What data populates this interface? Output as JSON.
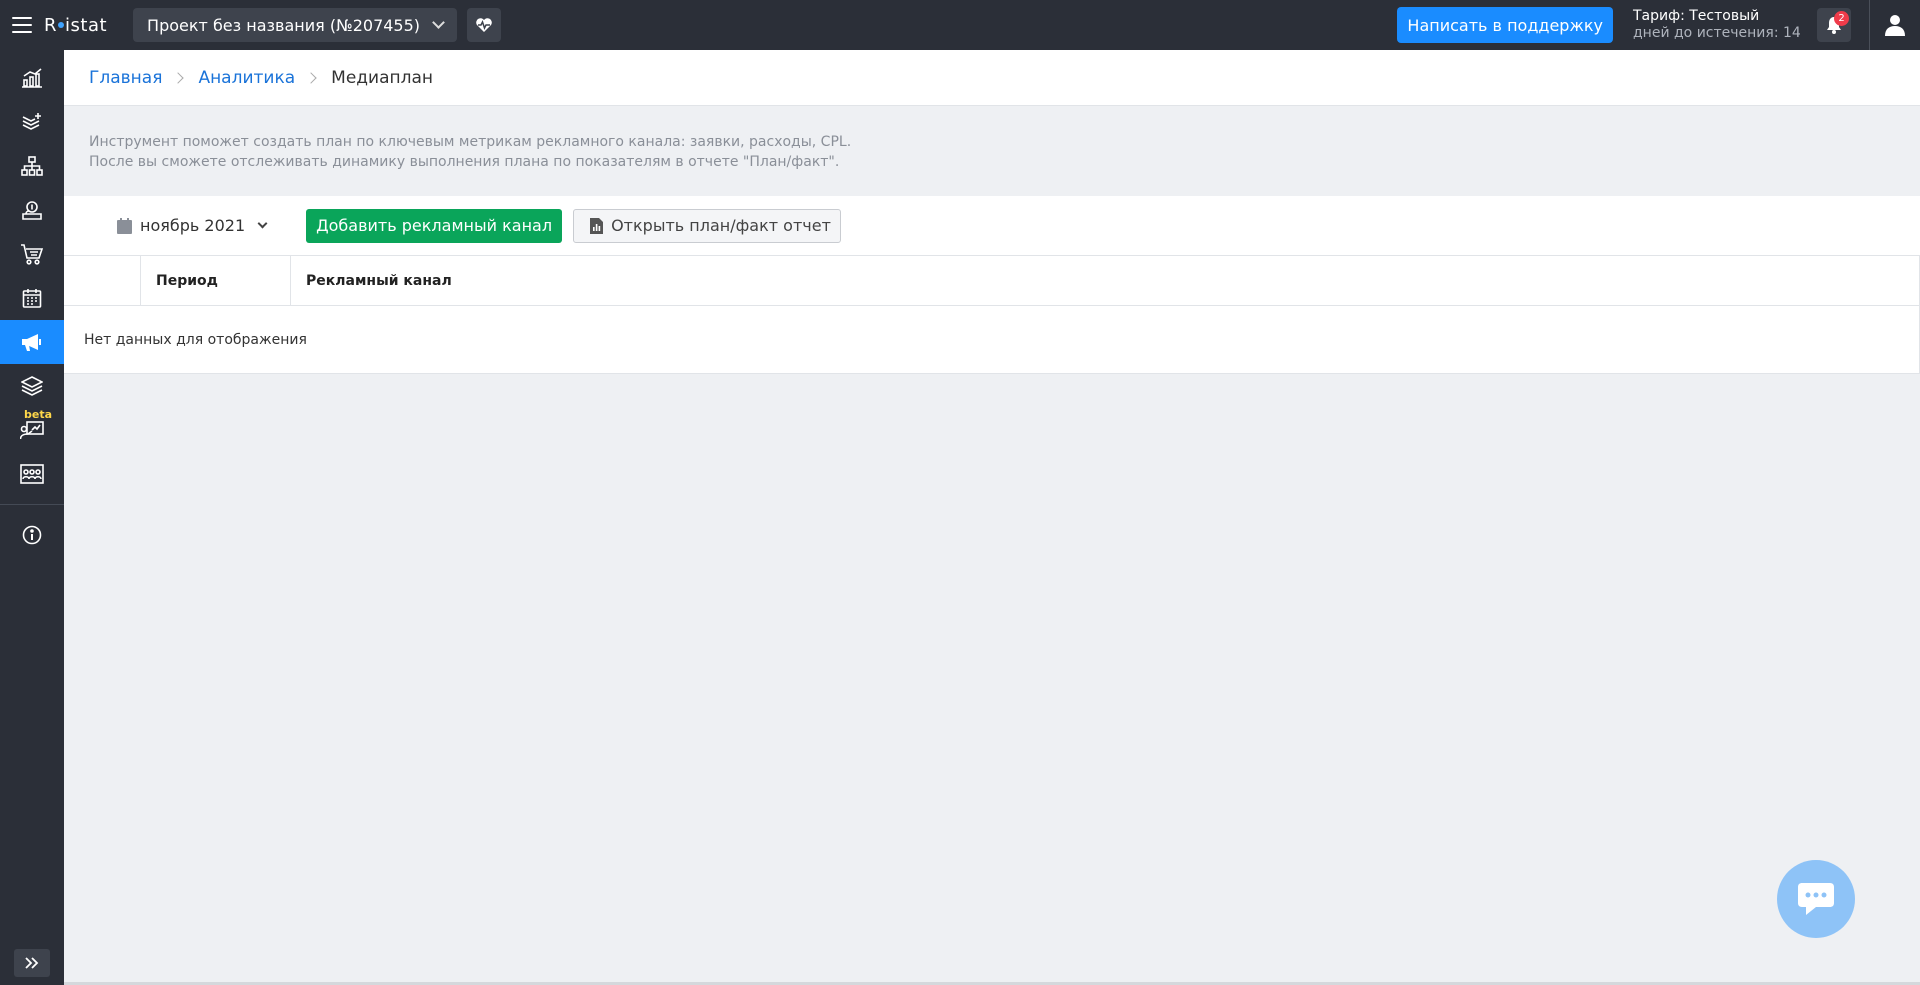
{
  "app": {
    "logo_text_pre": "R",
    "logo_text_post": "istat"
  },
  "header": {
    "project_name": "Проект без названия (№207455)",
    "support_label": "Написать в поддержку",
    "tariff_label": "Тариф: Тестовый",
    "days_left_label": "дней до истечения: 14",
    "notifications_count": "2"
  },
  "sidebar": {
    "items": [
      {
        "icon": "chart-icon"
      },
      {
        "icon": "stack-plus-icon"
      },
      {
        "icon": "hierarchy-icon"
      },
      {
        "icon": "money-user-icon"
      },
      {
        "icon": "cart-icon"
      },
      {
        "icon": "calendar-icon"
      },
      {
        "icon": "megaphone-icon",
        "active": true
      },
      {
        "icon": "layers-icon"
      },
      {
        "icon": "presenter-icon",
        "badge": "beta"
      },
      {
        "icon": "group-icon"
      }
    ],
    "beta_label": "beta"
  },
  "breadcrumb": {
    "home": "Главная",
    "analytics": "Аналитика",
    "current": "Медиаплан"
  },
  "info": {
    "line1": "Инструмент поможет создать план по ключевым метрикам рекламного канала: заявки, расходы, CPL.",
    "line2": "После вы сможете отслеживать динамику выполнения плана по показателям в отчете \"План/факт\"."
  },
  "toolbar": {
    "period": "ноябрь 2021",
    "add_channel": "Добавить рекламный канал",
    "open_report": "Открыть план/факт отчет"
  },
  "table": {
    "columns": [
      "",
      "Период",
      "Рекламный канал"
    ],
    "empty_text": "Нет данных для отображения"
  },
  "colors": {
    "topbar": "#2b2f38",
    "accent": "#1a8cff",
    "green": "#0aa55a"
  }
}
